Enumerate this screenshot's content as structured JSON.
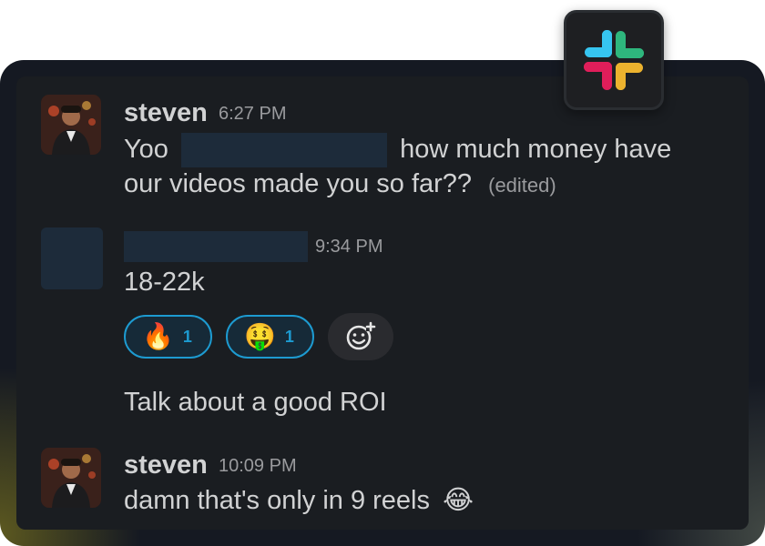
{
  "messages": [
    {
      "author": "steven",
      "time": "6:27 PM",
      "text_before": "Yoo",
      "text_after": "how much money have",
      "text_line2": "our videos made you so far??",
      "edited": "(edited)"
    },
    {
      "time": "9:34 PM",
      "text": "18-22k",
      "reactions": [
        {
          "emoji": "🔥",
          "count": "1"
        },
        {
          "emoji": "🤑",
          "count": "1"
        }
      ],
      "followup": "Talk about a good ROI"
    },
    {
      "author": "steven",
      "time": "10:09 PM",
      "text": "damn that's only in 9 reels",
      "emoji": "😂"
    }
  ],
  "icons": {
    "slack": "slack-logo-icon",
    "add_reaction": "add-reaction-icon"
  },
  "colors": {
    "background": "#1a1d21",
    "reaction_border": "#1d9bd1",
    "text": "#d1d2d3",
    "muted": "#9a9b9e"
  }
}
